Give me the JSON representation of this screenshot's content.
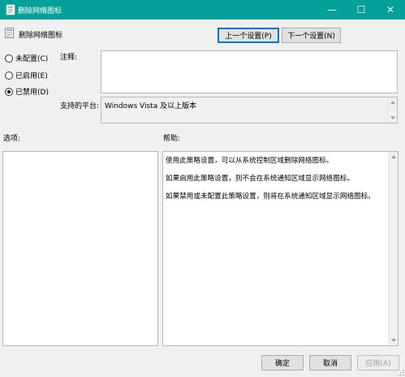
{
  "window": {
    "title": "删除网络图标",
    "icon": "policy-icon",
    "controls": {
      "minimize": "—",
      "maximize": "☐",
      "close": "✕"
    }
  },
  "header": {
    "policy_name": "删除网络图标",
    "prev_button": "上一个设置(P)",
    "next_button": "下一个设置(N)"
  },
  "state": {
    "options": [
      {
        "label": "未配置(C)",
        "checked": false
      },
      {
        "label": "已启用(E)",
        "checked": false
      },
      {
        "label": "已禁用(D)",
        "checked": true
      }
    ]
  },
  "comment": {
    "label": "注释:",
    "value": ""
  },
  "platform": {
    "label": "支持的平台:",
    "value": "Windows Vista 及以上版本"
  },
  "options_pane": {
    "label": "选项:"
  },
  "help_pane": {
    "label": "帮助:",
    "paragraphs": [
      "使用此策略设置，可以从系统控制区域删除网络图标。",
      "如果启用此策略设置，则不会在系统通知区域显示网络图标。",
      "如果禁用或未配置此策略设置，则将在系统通知区域显示网络图标。"
    ]
  },
  "footer": {
    "ok": "确定",
    "cancel": "取消",
    "apply": "应用(A)"
  },
  "colors": {
    "titlebar": "#06a09a",
    "focus_border": "#0078d7",
    "dialog_bg": "#f0f0f0"
  }
}
